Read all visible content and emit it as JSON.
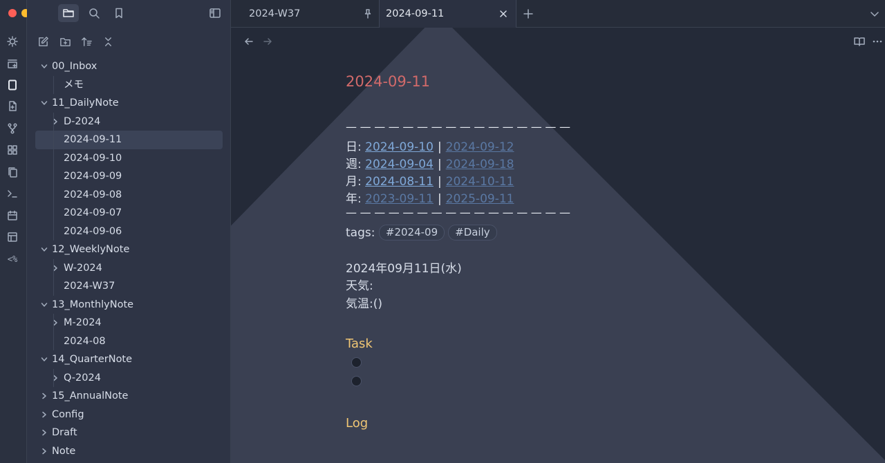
{
  "colors": {
    "accent": "#d26a6a",
    "heading2": "#f0c674",
    "link": "#7fa8d8",
    "unresolved_link": "#5a78a3"
  },
  "window": {
    "traffic_lights": [
      "close",
      "minimize",
      "zoom"
    ]
  },
  "ribbon": {
    "icons": [
      "lightbulb-icon",
      "new-card-icon",
      "tablet-icon",
      "file-import-icon",
      "git-branch-icon",
      "dashboard-icon",
      "copy-pages-icon",
      "terminal-icon",
      "calendar-icon",
      "layout-icon",
      "templater-icon"
    ],
    "templater_label": "<%"
  },
  "sidebar": {
    "top_icons": [
      "folder-icon",
      "search-icon",
      "bookmark-icon"
    ],
    "nav_icons": [
      "new-note-icon",
      "new-folder-icon",
      "sort-icon",
      "collapse-all-icon"
    ],
    "tree": [
      {
        "label": "00_Inbox",
        "level": 0,
        "type": "folder-open"
      },
      {
        "label": "メモ",
        "level": 1,
        "type": "file"
      },
      {
        "label": "11_DailyNote",
        "level": 0,
        "type": "folder-open"
      },
      {
        "label": "D-2024",
        "level": 1,
        "type": "folder-closed"
      },
      {
        "label": "2024-09-11",
        "level": 1,
        "type": "file",
        "selected": true
      },
      {
        "label": "2024-09-10",
        "level": 1,
        "type": "file"
      },
      {
        "label": "2024-09-09",
        "level": 1,
        "type": "file"
      },
      {
        "label": "2024-09-08",
        "level": 1,
        "type": "file"
      },
      {
        "label": "2024-09-07",
        "level": 1,
        "type": "file"
      },
      {
        "label": "2024-09-06",
        "level": 1,
        "type": "file"
      },
      {
        "label": "12_WeeklyNote",
        "level": 0,
        "type": "folder-open"
      },
      {
        "label": "W-2024",
        "level": 1,
        "type": "folder-closed"
      },
      {
        "label": "2024-W37",
        "level": 1,
        "type": "file"
      },
      {
        "label": "13_MonthlyNote",
        "level": 0,
        "type": "folder-open"
      },
      {
        "label": "M-2024",
        "level": 1,
        "type": "folder-closed"
      },
      {
        "label": "2024-08",
        "level": 1,
        "type": "file"
      },
      {
        "label": "14_QuarterNote",
        "level": 0,
        "type": "folder-open"
      },
      {
        "label": "Q-2024",
        "level": 1,
        "type": "folder-closed"
      },
      {
        "label": "15_AnnualNote",
        "level": 0,
        "type": "folder-closed"
      },
      {
        "label": "Config",
        "level": 0,
        "type": "folder-closed"
      },
      {
        "label": "Draft",
        "level": 0,
        "type": "folder-closed"
      },
      {
        "label": "Note",
        "level": 0,
        "type": "folder-closed"
      }
    ]
  },
  "tabs": [
    {
      "title": "2024-W37",
      "pinned": true,
      "active": false
    },
    {
      "title": "2024-09-11",
      "pinned": false,
      "active": true
    }
  ],
  "note": {
    "title": "2024-09-11",
    "divider": "————————————————",
    "nav_rows": [
      {
        "label": "日:",
        "prev": "2024-09-10",
        "next": "2024-09-12",
        "prev_resolved": true,
        "next_resolved": false
      },
      {
        "label": "週:",
        "prev": "2024-09-04",
        "next": "2024-09-18",
        "prev_resolved": true,
        "next_resolved": false
      },
      {
        "label": "月:",
        "prev": "2024-08-11",
        "next": "2024-10-11",
        "prev_resolved": true,
        "next_resolved": false
      },
      {
        "label": "年:",
        "prev": "2023-09-11",
        "next": "2025-09-11",
        "prev_resolved": false,
        "next_resolved": false
      }
    ],
    "separator": "|",
    "tags_label": "tags:",
    "tags": [
      "#2024-09",
      "#Daily"
    ],
    "date_line": "2024年09月11日(水)",
    "weather": "天気:",
    "temperature": "気温:()",
    "task_heading": "Task",
    "task_count": 2,
    "log_heading": "Log"
  }
}
